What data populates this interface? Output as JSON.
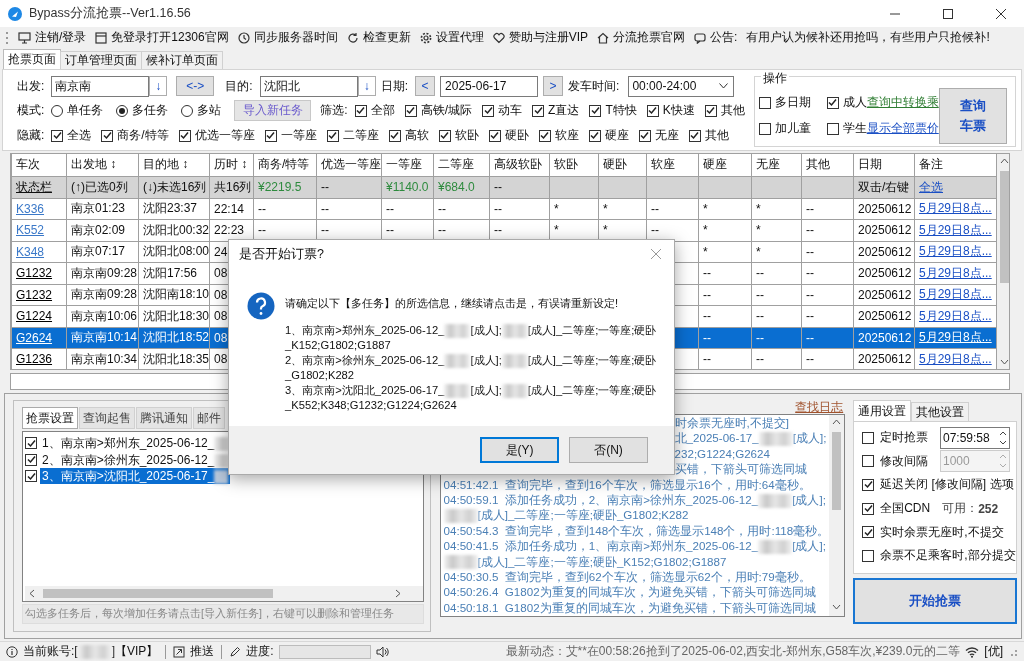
{
  "window": {
    "title": "Bypass分流抢票--Ver1.16.56"
  },
  "toolbar": [
    {
      "label": "注销/登录"
    },
    {
      "label": "免登录打开12306官网"
    },
    {
      "label": "同步服务器时间"
    },
    {
      "label": "检查更新"
    },
    {
      "label": "设置代理"
    },
    {
      "label": "赞助与注册VIP"
    },
    {
      "label": "分流抢票官网"
    },
    {
      "label": "公告:"
    }
  ],
  "notice": "有用户认为候补还用抢吗，有些用户只抢候补!",
  "main_tabs": [
    {
      "label": "抢票页面",
      "selected": true
    },
    {
      "label": "订单管理页面",
      "selected": false
    },
    {
      "label": "候补订单页面",
      "selected": false
    }
  ],
  "query": {
    "from_label": "出发:",
    "from": "南京南",
    "from_button": "↓",
    "swap_button": "<->",
    "to_label": "目的:",
    "to": "沈阳北",
    "to_button": "↓",
    "date_label": "日期:",
    "prev_button": "<",
    "date": "2025-06-17",
    "next_button": ">",
    "time_label": "发车时间:",
    "time": "00:00-24:00",
    "mode_label": "模式:",
    "modes": [
      {
        "label": "单任务",
        "selected": false
      },
      {
        "label": "多任务",
        "selected": true
      },
      {
        "label": "多站",
        "selected": false
      }
    ],
    "import_button": "导入新任务",
    "filter_label": "筛选:",
    "filters": [
      {
        "label": "全部",
        "checked": true
      },
      {
        "label": "高铁/城际",
        "checked": true
      },
      {
        "label": "动车",
        "checked": true
      },
      {
        "label": "Z直达",
        "checked": true
      },
      {
        "label": "T特快",
        "checked": true
      },
      {
        "label": "K快速",
        "checked": true
      },
      {
        "label": "其他",
        "checked": true
      }
    ],
    "hide_label": "隐藏:",
    "hides": [
      {
        "label": "全选",
        "checked": true
      },
      {
        "label": "商务/特等",
        "checked": true
      },
      {
        "label": "优选一等座",
        "checked": true
      },
      {
        "label": "一等座",
        "checked": true
      },
      {
        "label": "二等座",
        "checked": true
      },
      {
        "label": "高软",
        "checked": true
      },
      {
        "label": "软卧",
        "checked": true
      },
      {
        "label": "硬卧",
        "checked": true
      },
      {
        "label": "软座",
        "checked": true
      },
      {
        "label": "硬座",
        "checked": true
      },
      {
        "label": "无座",
        "checked": true
      },
      {
        "label": "其他",
        "checked": true
      }
    ]
  },
  "operations": {
    "title": "操作",
    "options": [
      {
        "label": "多日期",
        "checked": false
      },
      {
        "label": "成人",
        "checked": true
      },
      {
        "label": "加儿童",
        "checked": false
      },
      {
        "label": "学生",
        "checked": false
      }
    ],
    "links": [
      {
        "label": "查询中转换乘",
        "color": "#2e7d32"
      },
      {
        "label": "显示全部票价",
        "color": "#1a4fc4"
      }
    ],
    "query_button": "查询车票"
  },
  "table": {
    "columns": [
      {
        "label": "车次"
      },
      {
        "label": "出发地 ↕"
      },
      {
        "label": "目的地 ↕"
      },
      {
        "label": "历时 ↕"
      },
      {
        "label": "商务/特等"
      },
      {
        "label": "优选一等座"
      },
      {
        "label": "一等座"
      },
      {
        "label": "二等座"
      },
      {
        "label": "高级软卧"
      },
      {
        "label": "软卧"
      },
      {
        "label": "硬卧"
      },
      {
        "label": "软座"
      },
      {
        "label": "硬座"
      },
      {
        "label": "无座"
      },
      {
        "label": "其他"
      },
      {
        "label": "日期"
      },
      {
        "label": "备注",
        "kind": "link"
      }
    ],
    "summary": [
      {
        "text": "状态栏",
        "kind": "label"
      },
      {
        "text": "(↑)已选0列"
      },
      {
        "text": "(↓)未选16列"
      },
      {
        "text": "共16列"
      },
      {
        "text": "¥2219.5",
        "kind": "price"
      },
      {
        "text": "--"
      },
      {
        "text": "¥1140.0",
        "kind": "price"
      },
      {
        "text": "¥684.0",
        "kind": "price"
      },
      {
        "text": "--"
      },
      {
        "kind": "empty"
      },
      {
        "kind": "empty"
      },
      {
        "kind": "empty"
      },
      {
        "kind": "empty"
      },
      {
        "kind": "empty"
      },
      {
        "kind": "empty"
      },
      {
        "text": "双击/右键"
      },
      {
        "text": "全选",
        "kind": "link"
      }
    ],
    "rows": [
      {
        "kind": "normal",
        "selected": false,
        "cells": [
          "K336",
          "南京01:23",
          "沈阳23:37",
          "22:14",
          "--",
          "--",
          "--",
          "--",
          "--",
          "*",
          "*",
          "--",
          "*",
          "*",
          "--",
          "20250612",
          "5月29日8点..."
        ]
      },
      {
        "kind": "normal",
        "selected": false,
        "cells": [
          "K552",
          "南京02:09",
          "沈阳北00:32",
          "22:23",
          "--",
          "--",
          "--",
          "--",
          "--",
          "*",
          "*",
          "--",
          "*",
          "*",
          "--",
          "20250612",
          "5月29日8点..."
        ]
      },
      {
        "kind": "normal",
        "selected": false,
        "cells": [
          "K348",
          "南京07:17",
          "沈阳北08:00",
          "24",
          null,
          null,
          null,
          null,
          null,
          null,
          null,
          null,
          "*",
          "*",
          "--",
          "20250612",
          "5月29日8点..."
        ]
      },
      {
        "kind": "highspeed",
        "selected": false,
        "cells": [
          "G1232",
          "南京南09:28",
          "沈阳17:56",
          "08",
          null,
          null,
          null,
          null,
          null,
          null,
          null,
          null,
          "--",
          "--",
          "--",
          "20250612",
          "5月29日8点..."
        ]
      },
      {
        "kind": "highspeed",
        "selected": false,
        "cells": [
          "G1232",
          "南京南09:28",
          "沈阳南18:10",
          "08",
          null,
          null,
          null,
          null,
          null,
          null,
          null,
          null,
          "--",
          "--",
          "--",
          "20250612",
          "5月29日8点..."
        ]
      },
      {
        "kind": "highspeed",
        "selected": false,
        "cells": [
          "G1224",
          "南京南10:06",
          "沈阳北18:30",
          "08",
          null,
          null,
          null,
          null,
          null,
          null,
          null,
          null,
          "--",
          "--",
          "--",
          "20250612",
          "5月29日8点..."
        ]
      },
      {
        "kind": "highspeed",
        "selected": true,
        "cells": [
          "G2624",
          "南京南10:14",
          "沈阳北18:52",
          "08",
          null,
          null,
          null,
          null,
          null,
          null,
          null,
          null,
          "--",
          "--",
          "--",
          "20250612",
          "5月29日8点..."
        ]
      },
      {
        "kind": "highspeed",
        "selected": false,
        "cells": [
          "G1236",
          "南京南10:34",
          "沈阳北18:35",
          "08",
          null,
          null,
          null,
          null,
          null,
          null,
          null,
          null,
          "--",
          "--",
          "--",
          "20250612",
          "5月29日8点..."
        ]
      }
    ]
  },
  "task_tabs": [
    {
      "label": "抢票设置",
      "selected": true
    },
    {
      "label": "查询起售",
      "selected": false
    },
    {
      "label": "腾讯通知",
      "selected": false
    },
    {
      "label": "邮件",
      "selected": false
    }
  ],
  "tasks": [
    {
      "checked": true,
      "selected": false,
      "segments": [
        "1、南京南>郑州东_2025-06-12_",
        {
          "kind": "redacted"
        }
      ]
    },
    {
      "checked": true,
      "selected": false,
      "segments": [
        "2、南京南>徐州东_2025-06-12_",
        {
          "kind": "redacted"
        }
      ]
    },
    {
      "checked": true,
      "selected": true,
      "segments": [
        "3、南京南>沈阳北_2025-06-17_",
        {
          "kind": "redacted"
        }
      ]
    }
  ],
  "task_hint": "勾选多任务后，每次增加任务请点击[导入新任务]，右键可以删除和管理任务",
  "log_link": "查找日志",
  "log": [
    {
      "kind": "partial",
      "lines": [
        [
          "时余票无座时,不提交]"
        ],
        [
          "北_2025-06-17_",
          {
            "kind": "redacted"
          },
          "[成人];"
        ],
        [
          "232;G1224;G2624"
        ],
        [
          "买错，下箭头可筛选同城"
        ]
      ]
    },
    {
      "kind": "entry",
      "lines": [
        [
          "04:51:42.1  查询完毕，查到16个车次，筛选显示16个，用时:64毫秒。"
        ]
      ]
    },
    {
      "kind": "entry",
      "lines": [
        [
          "04:50:59.1  添加任务成功，2、南京南>徐州东_2025-06-12_",
          {
            "kind": "redacted"
          },
          "[成人];"
        ],
        [
          {
            "kind": "redacted"
          },
          "[成人]_二等座;一等座;硬卧_G1802;K282"
        ]
      ]
    },
    {
      "kind": "entry",
      "lines": [
        [
          "04:50:54.3  查询完毕，查到148个车次，筛选显示148个，用时:118毫秒。"
        ]
      ]
    },
    {
      "kind": "entry",
      "lines": [
        [
          "04:50:41.5  添加任务成功，1、南京南>郑州东_2025-06-12_",
          {
            "kind": "redacted"
          },
          "[成人];"
        ],
        [
          {
            "kind": "redacted"
          },
          "[成人]_二等座;一等座;硬卧_K152;G1802;G1887"
        ]
      ]
    },
    {
      "kind": "entry",
      "lines": [
        [
          "04:50:30.5  查询完毕，查到62个车次，筛选显示62个，用时:79毫秒。"
        ]
      ]
    },
    {
      "kind": "entry",
      "lines": [
        [
          "04:50:26.4  G1802为重复的同城车次，为避免买错，下箭头可筛选同城"
        ]
      ]
    },
    {
      "kind": "entry",
      "lines": [
        [
          "04:50:18.1  G1802为重复的同城车次，为避免买错，下箭头可筛选同城"
        ]
      ]
    }
  ],
  "settings_tabs": [
    {
      "label": "通用设置",
      "selected": true
    },
    {
      "label": "其他设置",
      "selected": false
    }
  ],
  "settings": [
    {
      "kind": "spin",
      "label": "定时抢票",
      "checked": false,
      "value": "07:59:58",
      "disabled": false
    },
    {
      "kind": "spin",
      "label": "修改间隔",
      "checked": false,
      "value": "1000",
      "disabled": true
    },
    {
      "kind": "check",
      "label": "延迟关闭 [修改间隔] 选项",
      "checked": true
    },
    {
      "kind": "cdn",
      "label": "全国CDN",
      "checked": true,
      "note": "可用：",
      "count": "252"
    },
    {
      "kind": "check",
      "label": "实时余票无座时,不提交",
      "checked": true
    },
    {
      "kind": "check",
      "label": "余票不足乘客时,部分提交",
      "checked": false
    }
  ],
  "start_button": "开始抢票",
  "status_bar": {
    "account": [
      "当前账号:[",
      {
        "kind": "redacted"
      },
      "]【VIP】"
    ],
    "push": "推送",
    "progress_label": "进度:",
    "progress": {
      "level": 0
    },
    "news": "最新动态：艾**在00:58:26抢到了2025-06-02,西安北-郑州东,G58车次,¥239.0元的二等",
    "quality": "[优]"
  },
  "dialog": {
    "title": "是否开始订票?",
    "message": "请确定以下【多任务】的所选信息，继续请点击是，有误请重新设定!",
    "items": [
      [
        [
          "1、南京南>郑州东_2025-06-12_",
          {
            "kind": "redacted"
          },
          "[成人];",
          {
            "kind": "redacted"
          },
          "[成人]_二等座;一等座;硬卧"
        ],
        [
          "_K152;G1802;G1887"
        ]
      ],
      [
        [
          "2、南京南>徐州东_2025-06-12_",
          {
            "kind": "redacted"
          },
          "[成人];",
          {
            "kind": "redacted"
          },
          "[成人]_二等座;一等座;硬卧"
        ],
        [
          "_G1802;K282"
        ]
      ],
      [
        [
          "3、南京南>沈阳北_2025-06-17_",
          {
            "kind": "redacted"
          },
          "[成人];",
          {
            "kind": "redacted"
          },
          "[成人]_二等座;一等座;硬卧"
        ],
        [
          "_K552;K348;G1232;G1224;G2624"
        ]
      ]
    ],
    "buttons": [
      {
        "label": "是(Y)",
        "focused": true
      },
      {
        "label": "否(N)",
        "focused": false
      }
    ]
  }
}
